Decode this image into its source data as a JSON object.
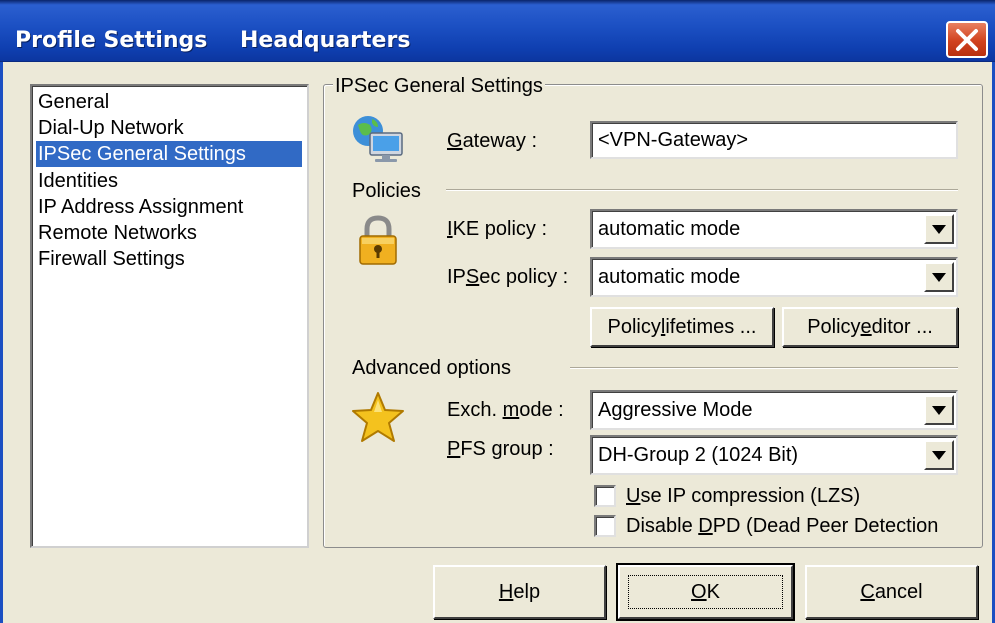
{
  "window": {
    "title": "Profile Settings",
    "subtitle": "Headquarters",
    "close_icon": "close-icon"
  },
  "nav": {
    "items": [
      {
        "label": "General",
        "selected": false
      },
      {
        "label": "Dial-Up Network",
        "selected": false
      },
      {
        "label": "IPSec General Settings",
        "selected": true
      },
      {
        "label": "Identities",
        "selected": false
      },
      {
        "label": "IP Address Assignment",
        "selected": false
      },
      {
        "label": "Remote Networks",
        "selected": false
      },
      {
        "label": "Firewall Settings",
        "selected": false
      }
    ]
  },
  "group": {
    "title": "IPSec General Settings",
    "gateway": {
      "label_prefix": "",
      "label_underline": "G",
      "label_rest": "ateway :",
      "value": "<VPN-Gateway>",
      "icon": "network-computer-icon"
    },
    "policies": {
      "section_title": "Policies",
      "icon": "padlock-icon",
      "ike": {
        "label_prefix": "",
        "label_underline": "I",
        "label_rest": "KE policy :",
        "value": "automatic mode"
      },
      "ipsec": {
        "label_prefix": "IP",
        "label_underline": "S",
        "label_rest": "ec policy :",
        "value": "automatic mode"
      },
      "lifetimes_button": {
        "prefix": "Policy ",
        "underline": "l",
        "rest": "ifetimes ..."
      },
      "editor_button": {
        "prefix": "Policy ",
        "underline": "e",
        "rest": "ditor ..."
      }
    },
    "advanced": {
      "section_title": "Advanced options",
      "icon": "star-icon",
      "exch": {
        "label_prefix": "Exch. ",
        "label_underline": "m",
        "label_rest": "ode :",
        "value": "Aggressive Mode"
      },
      "pfs": {
        "label_prefix": "",
        "label_underline": "P",
        "label_rest": "FS group :",
        "value": "DH-Group 2 (1024 Bit)"
      },
      "ip_compression": {
        "prefix": "",
        "underline": "U",
        "rest": "se IP compression (LZS)",
        "checked": false
      },
      "disable_dpd": {
        "prefix": "Disable ",
        "underline": "D",
        "rest": "PD (Dead Peer Detection",
        "checked": false
      }
    }
  },
  "footer": {
    "help": {
      "prefix": "",
      "underline": "H",
      "rest": "elp"
    },
    "ok": {
      "prefix": "",
      "underline": "O",
      "rest": "K"
    },
    "cancel": {
      "prefix": "",
      "underline": "C",
      "rest": "ancel"
    }
  },
  "colors": {
    "titlebar": "#1b4fc2",
    "selection": "#316ac5",
    "dialog_bg": "#ece9d8",
    "close_button": "#d1421e"
  }
}
